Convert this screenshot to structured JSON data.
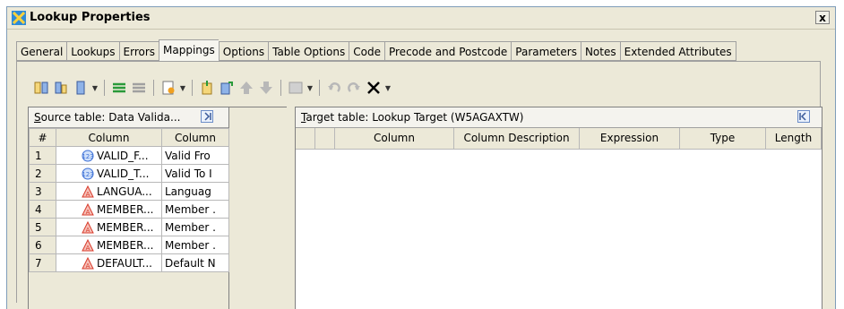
{
  "window": {
    "title": "Lookup Properties",
    "close_label": "x"
  },
  "tabs": [
    {
      "label": "General",
      "active": false
    },
    {
      "label": "Lookups",
      "active": false
    },
    {
      "label": "Errors",
      "active": false
    },
    {
      "label": "Mappings",
      "active": true
    },
    {
      "label": "Options",
      "active": false
    },
    {
      "label": "Table Options",
      "active": false
    },
    {
      "label": "Code",
      "active": false
    },
    {
      "label": "Precode and Postcode",
      "active": false
    },
    {
      "label": "Parameters",
      "active": false
    },
    {
      "label": "Notes",
      "active": false
    },
    {
      "label": "Extended Attributes",
      "active": false
    }
  ],
  "toolbar": {
    "icons": [
      "map-columns-icon",
      "quick-map-icon",
      "column-icon",
      "map-all-icon",
      "unmap-icon",
      "expression-icon",
      "import-icon",
      "export-icon",
      "move-up-icon",
      "move-down-icon",
      "grid-icon",
      "undo-icon",
      "redo-icon",
      "delete-icon"
    ]
  },
  "source": {
    "label_prefix": "S",
    "label_rest": "ource table: Data Valida...",
    "headers": {
      "num": "#",
      "column": "Column",
      "description": "Column"
    },
    "rows": [
      {
        "num": "1",
        "type": "numeric",
        "column": "VALID_F...",
        "description": "Valid Fro"
      },
      {
        "num": "2",
        "type": "numeric",
        "column": "VALID_T...",
        "description": "Valid To I"
      },
      {
        "num": "3",
        "type": "character",
        "column": "LANGUA...",
        "description": "Languag"
      },
      {
        "num": "4",
        "type": "character",
        "column": "MEMBER...",
        "description": "Member ."
      },
      {
        "num": "5",
        "type": "character",
        "column": "MEMBER...",
        "description": "Member ."
      },
      {
        "num": "6",
        "type": "character",
        "column": "MEMBER...",
        "description": "Member ."
      },
      {
        "num": "7",
        "type": "character",
        "column": "DEFAULT...",
        "description": "Default N"
      }
    ]
  },
  "target": {
    "label_prefix": "T",
    "label_rest": "arget table: Lookup Target (W5AGAXTW)",
    "headers": [
      "",
      "",
      "Column",
      "Column Description",
      "Expression",
      "Type",
      "Length"
    ]
  },
  "colors": {
    "numeric_icon": "#3b6fd6",
    "character_icon": "#d83a2a",
    "window_bg": "#ece9d8"
  }
}
